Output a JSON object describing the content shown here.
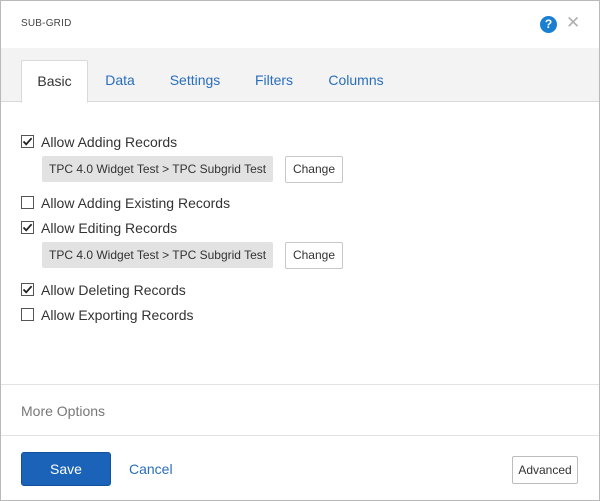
{
  "dialog": {
    "title": "SUB-GRID",
    "help_icon": "question-circle-icon",
    "help_glyph": "?",
    "close_icon": "close-icon",
    "close_glyph": "✕"
  },
  "tabs": [
    {
      "label": "Basic",
      "active": true
    },
    {
      "label": "Data",
      "active": false
    },
    {
      "label": "Settings",
      "active": false
    },
    {
      "label": "Filters",
      "active": false
    },
    {
      "label": "Columns",
      "active": false
    }
  ],
  "options": {
    "allow_adding": {
      "label": "Allow Adding Records",
      "checked": true,
      "target": "TPC 4.0 Widget Test > TPC Subgrid Test",
      "change_label": "Change"
    },
    "allow_adding_existing": {
      "label": "Allow Adding Existing Records",
      "checked": false
    },
    "allow_editing": {
      "label": "Allow Editing Records",
      "checked": true,
      "target": "TPC 4.0 Widget Test > TPC Subgrid Test",
      "change_label": "Change"
    },
    "allow_deleting": {
      "label": "Allow Deleting Records",
      "checked": true
    },
    "allow_exporting": {
      "label": "Allow Exporting Records",
      "checked": false
    }
  },
  "more_options": "More Options",
  "footer": {
    "save_label": "Save",
    "cancel_label": "Cancel",
    "advanced_label": "Advanced"
  },
  "colors": {
    "accent": "#1a63b8",
    "link": "#2a6ebb",
    "help": "#1a7fd1"
  }
}
